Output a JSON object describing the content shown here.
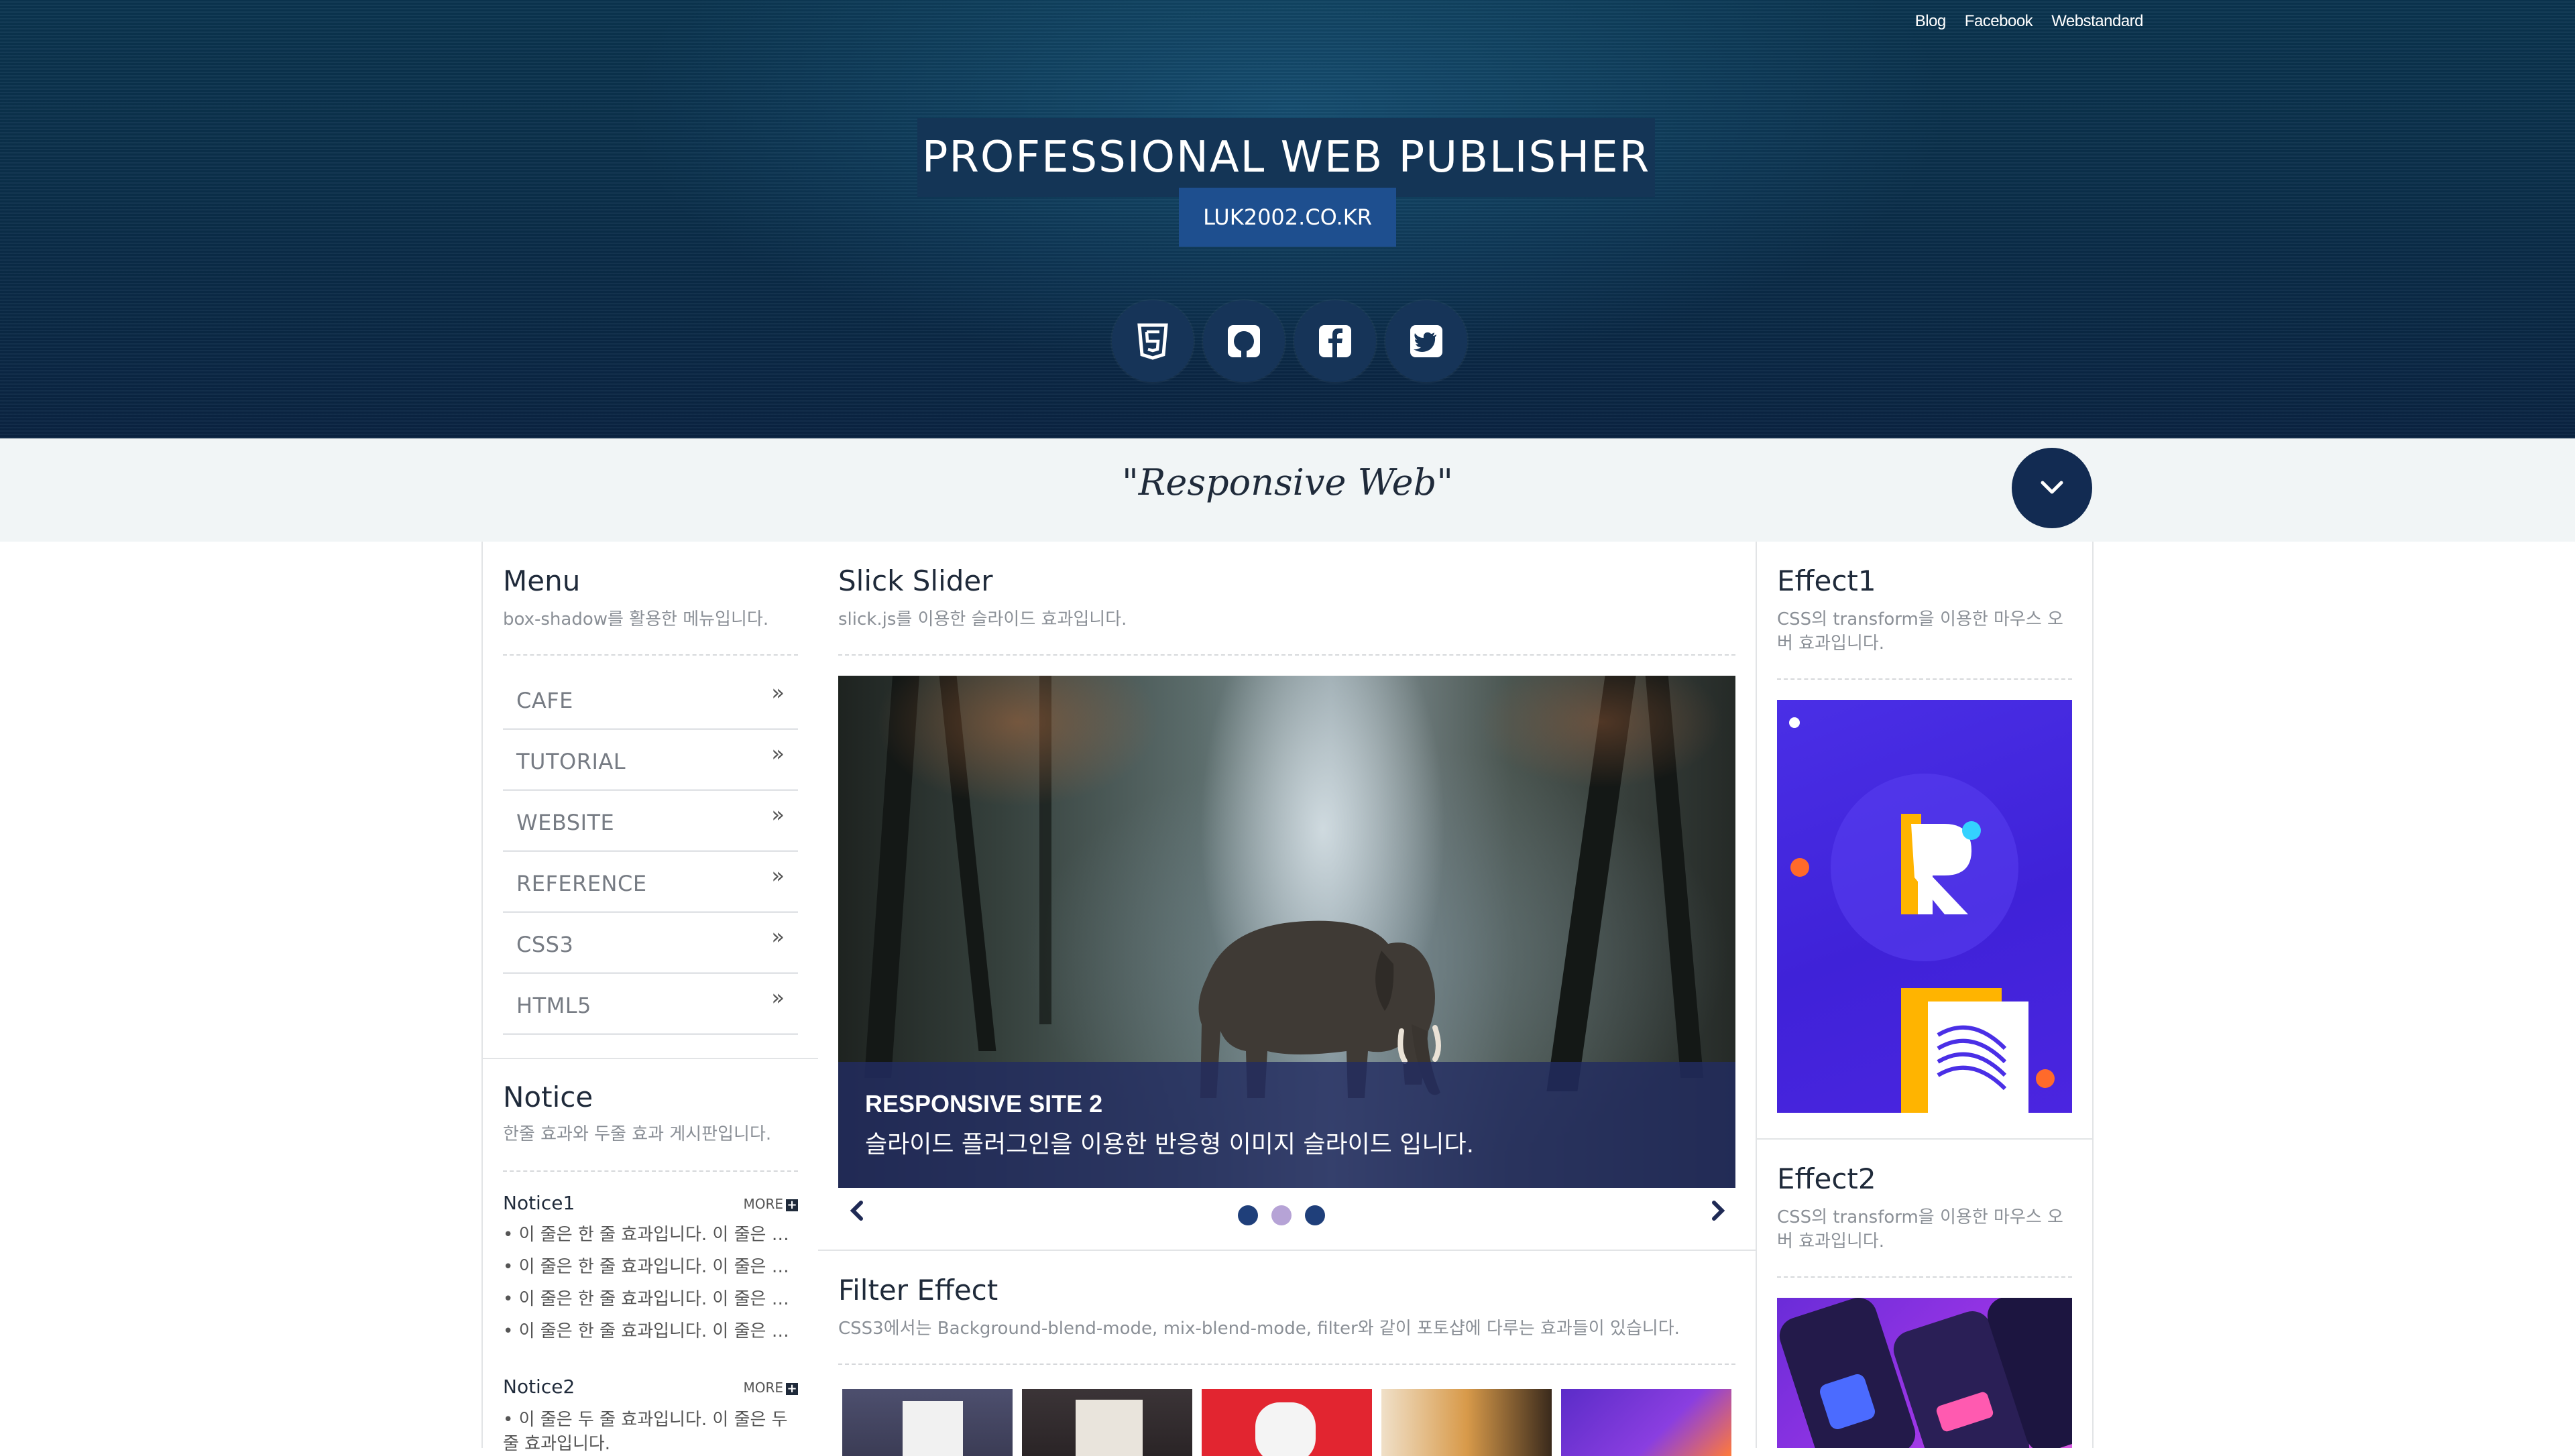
{
  "header": {
    "top_links": [
      "Blog",
      "Facebook",
      "Webstandard"
    ],
    "title": "PROFESSIONAL WEB PUBLISHER",
    "subtitle": "LUK2002.CO.KR",
    "social_icons": [
      "html5-icon",
      "github-icon",
      "facebook-icon",
      "twitter-icon"
    ]
  },
  "slogan": "\"Responsive Web\"",
  "menu": {
    "title": "Menu",
    "desc": "box-shadow를 활용한 메뉴입니다.",
    "items": [
      "CAFE",
      "TUTORIAL",
      "WEBSITE",
      "REFERENCE",
      "CSS3",
      "HTML5"
    ]
  },
  "notice": {
    "title": "Notice",
    "desc": "한줄 효과와 두줄 효과 게시판입니다.",
    "notice1": {
      "title": "Notice1",
      "more": "MORE",
      "items": [
        "이 줄은 한 줄 효과입니다. 이 줄은 한 줄 효과입니다.",
        "이 줄은 한 줄 효과입니다. 이 줄은 한 줄 효과입니다.",
        "이 줄은 한 줄 효과입니다. 이 줄은 한 줄 효과입니다.",
        "이 줄은 한 줄 효과입니다. 이 줄은 한 줄 효과입니다."
      ]
    },
    "notice2": {
      "title": "Notice2",
      "more": "MORE",
      "item": "이 줄은 두 줄 효과입니다. 이 줄은 두 줄 효과입니다."
    }
  },
  "slider": {
    "title": "Slick Slider",
    "desc": "slick.js를 이용한 슬라이드 효과입니다.",
    "caption_title": "RESPONSIVE SITE 2",
    "caption_desc": "슬라이드 플러그인을 이용한 반응형 이미지 슬라이드 입니다.",
    "dots_count": 3,
    "active_dot": 2
  },
  "filter": {
    "title": "Filter Effect",
    "desc": "CSS3에서는 Background-blend-mode, mix-blend-mode, filter와 같이 포토샵에 다루는 효과들이 있습니다."
  },
  "effect1": {
    "title": "Effect1",
    "desc": "CSS의 transform을 이용한 마우스 오버 효과입니다."
  },
  "effect2": {
    "title": "Effect2",
    "desc": "CSS의 transform을 이용한 마우스 오버 효과입니다."
  },
  "colors": {
    "header_bg": "#0b2f4b",
    "title_box": "#143556",
    "subtitle_box": "#1e4f8f",
    "accent_dark": "#122b52",
    "active_dot": "#b6a3d6"
  }
}
